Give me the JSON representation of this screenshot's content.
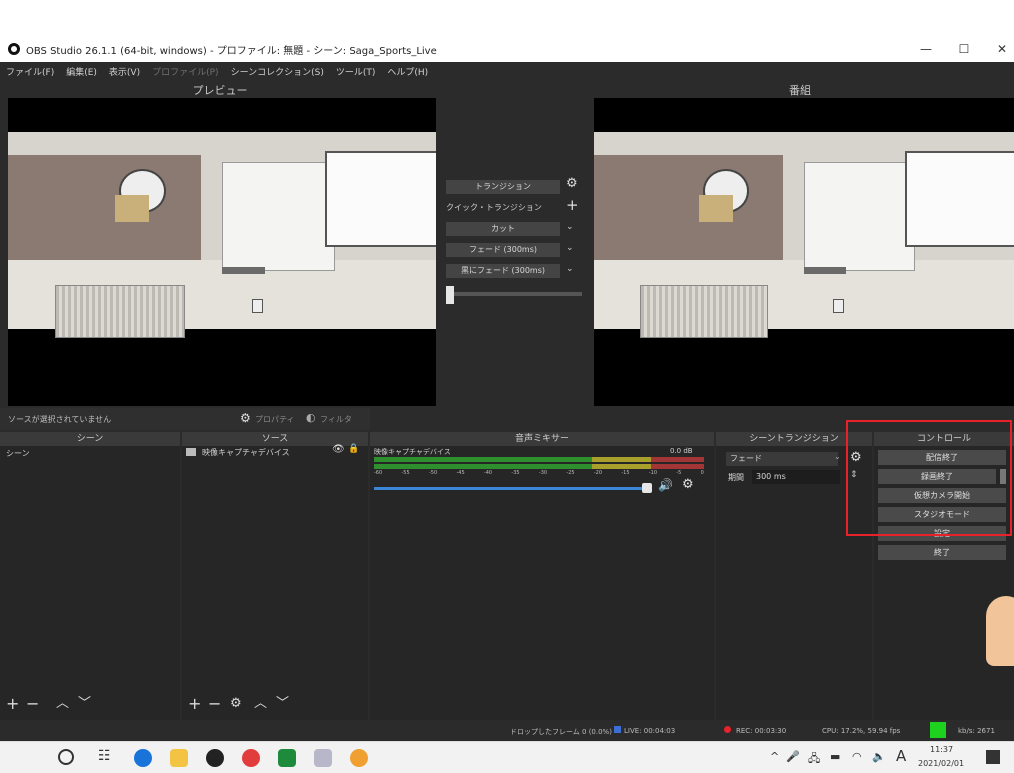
{
  "window": {
    "title": "OBS Studio 26.1.1 (64-bit, windows) - プロファイル: 無題 - シーン: Saga_Sports_Live",
    "minimize": "—",
    "maximize": "☐",
    "close": "✕"
  },
  "menu": [
    "ファイル(F)",
    "編集(E)",
    "表示(V)",
    "プロファイル(P)",
    "シーンコレクション(S)",
    "ツール(T)",
    "ヘルプ(H)"
  ],
  "preview_title": "プレビュー",
  "program_title": "番組",
  "transition": {
    "button": "トランジション",
    "quick": "クイック・トランジション",
    "items": [
      "カット",
      "フェード (300ms)",
      "黒にフェード (300ms)"
    ],
    "add": "+"
  },
  "source_bar": {
    "no_source": "ソースが選択されていません",
    "properties": "プロパティ",
    "filters": "フィルタ"
  },
  "docks": {
    "scenes": {
      "title": "シーン",
      "items": [
        "シーン"
      ]
    },
    "sources": {
      "title": "ソース",
      "items": [
        "映像キャプチャデバイス"
      ]
    },
    "mixer": {
      "title": "音声ミキサー",
      "channel": "映像キャプチャデバイス",
      "level": "0.0 dB",
      "ticks": [
        "-60",
        "-55",
        "-50",
        "-45",
        "-40",
        "-35",
        "-30",
        "-25",
        "-20",
        "-15",
        "-10",
        "-5",
        "0"
      ]
    },
    "scene_transitions": {
      "title": "シーントランジション",
      "type": "フェード",
      "duration_label": "期間",
      "duration": "300 ms"
    },
    "controls": {
      "title": "コントロール",
      "buttons": [
        "配信終了",
        "録画終了",
        "仮想カメラ開始",
        "スタジオモード",
        "設定",
        "終了"
      ]
    }
  },
  "status": {
    "dropped": "ドロップしたフレーム 0 (0.0%)",
    "live": "LIVE: 00:04:03",
    "rec": "REC: 00:03:30",
    "cpu": "CPU: 17.2%, 59.94 fps",
    "kbps": "kb/s: 2671"
  },
  "taskbar": {
    "tray": "^",
    "ime": "A",
    "time": "11:37",
    "date": "2021/02/01"
  },
  "colors": {
    "accent_red": "#e8212a",
    "live_green": "#1fd11f"
  }
}
